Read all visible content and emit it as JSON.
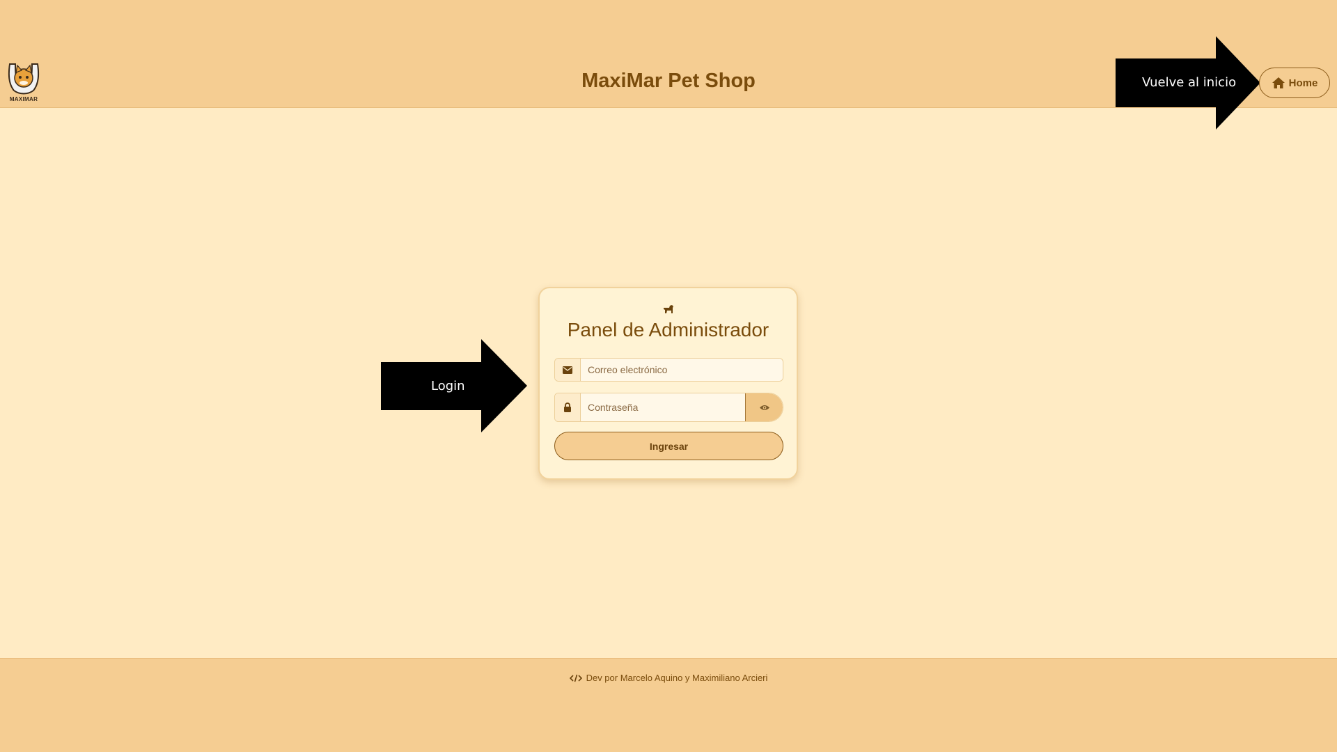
{
  "header": {
    "logo_text": "MAXIMAR",
    "title": "MaxiMar Pet Shop",
    "home_label": "Home"
  },
  "annotations": {
    "home_note": "Vuelve al inicio",
    "login_note": "Login"
  },
  "login": {
    "title": "Panel de Administrador",
    "email_placeholder": "Correo electrónico",
    "password_placeholder": "Contraseña",
    "submit_label": "Ingresar"
  },
  "footer": {
    "credit": "Dev por Marcelo Aquino y Maximiliano Arcieri"
  },
  "icons": {
    "logo": "cat-logo-icon",
    "home": "home-icon",
    "dog": "dog-icon",
    "email": "envelope-icon",
    "password": "lock-icon",
    "toggle": "eye-icon",
    "code": "code-icon"
  },
  "colors": {
    "header_bg": "#f5cd92",
    "page_bg": "#ffebc4",
    "card_bg": "#fff3d4",
    "text_brown": "#7a4c0c",
    "annotation_black": "#000000"
  }
}
